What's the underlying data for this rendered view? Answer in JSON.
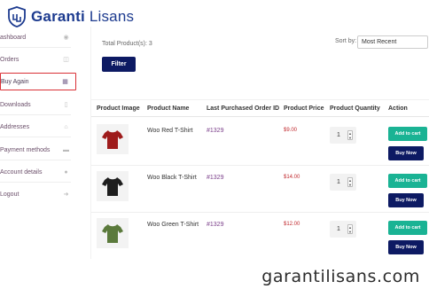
{
  "brand": {
    "name_bold": "Garanti",
    "name_light": " Lisans"
  },
  "sidebar": {
    "items": [
      {
        "label": "ashboard",
        "icon": "dashboard-icon"
      },
      {
        "label": "Orders",
        "icon": "basket-icon"
      },
      {
        "label": "Buy Again",
        "icon": "document-icon",
        "active": true
      },
      {
        "label": "Downloads",
        "icon": "file-icon"
      },
      {
        "label": "Addresses",
        "icon": "home-icon"
      },
      {
        "label": "Payment methods",
        "icon": "card-icon"
      },
      {
        "label": "Account details",
        "icon": "user-icon"
      },
      {
        "label": "Logout",
        "icon": "logout-icon"
      }
    ]
  },
  "main": {
    "total_products": "Total Product(s): 3",
    "filter_label": "Filter",
    "sort_label": "Sort by:",
    "sort_value": "Most Recent",
    "columns": [
      "Product Image",
      "Product Name",
      "Last Purchased Order ID",
      "Product Price",
      "Product Quantity",
      "Action"
    ],
    "rows": [
      {
        "name": "Woo Red T-Shirt",
        "order_id": "#1329",
        "price": "$9.00",
        "quantity": "1",
        "shirt_color": "#9e1c1c",
        "add_label": "Add to cart",
        "buy_label": "Buy Now"
      },
      {
        "name": "Woo Black T-Shirt",
        "order_id": "#1329",
        "price": "$14.00",
        "quantity": "1",
        "shirt_color": "#1e1e1e",
        "add_label": "Add to cart",
        "buy_label": "Buy Now"
      },
      {
        "name": "Woo Green T-Shirt",
        "order_id": "#1329",
        "price": "$12.00",
        "quantity": "1",
        "shirt_color": "#5b7a3c",
        "add_label": "Add to cart",
        "buy_label": "Buy Now"
      }
    ]
  },
  "watermark": {
    "url": "garantilisans.com"
  },
  "colors": {
    "primary_button": "#0d1a63",
    "add_to_cart": "#1ab394",
    "price": "#c0282d",
    "active_border": "#d93036"
  }
}
